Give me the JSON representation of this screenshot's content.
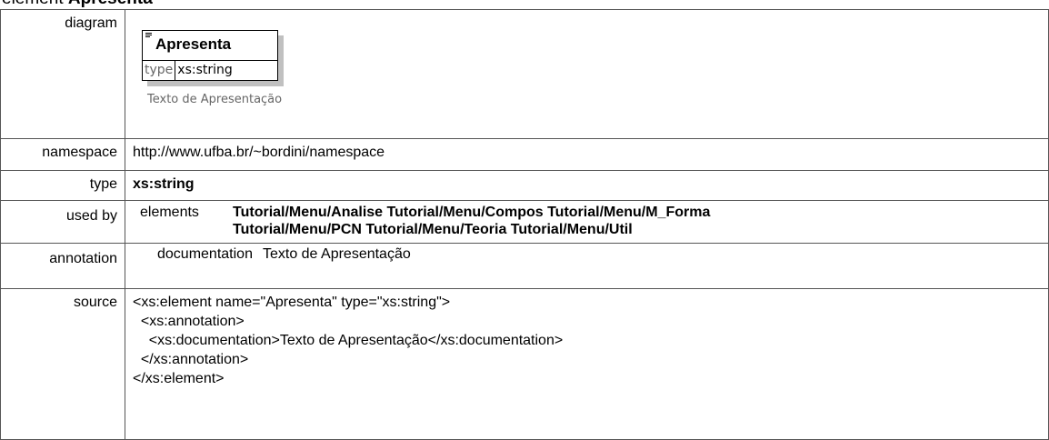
{
  "heading": {
    "prefix": "element ",
    "name": "Apresenta"
  },
  "labels": {
    "diagram": "diagram",
    "namespace": "namespace",
    "type": "type",
    "used_by": "used by",
    "annotation": "annotation",
    "source": "source"
  },
  "diagram": {
    "element_name": "Apresenta",
    "attr_key": "type",
    "attr_value": "xs:string",
    "caption": "Texto de Apresentação",
    "icon": "documentation-lines-icon"
  },
  "namespace": "http://www.ufba.br/~bordini/namespace",
  "type": "xs:string",
  "used_by": {
    "key": "elements",
    "line1": "Tutorial/Menu/Analise Tutorial/Menu/Compos Tutorial/Menu/M_Forma",
    "line2": "Tutorial/Menu/PCN Tutorial/Menu/Teoria Tutorial/Menu/Util"
  },
  "annotation": {
    "key": "documentation",
    "value": "Texto de Apresentação"
  },
  "source": {
    "lines": [
      "<xs:element name=\"Apresenta\" type=\"xs:string\">",
      "  <xs:annotation>",
      "    <xs:documentation>Texto de Apresentação</xs:documentation>",
      "  </xs:annotation>",
      "</xs:element>"
    ]
  }
}
